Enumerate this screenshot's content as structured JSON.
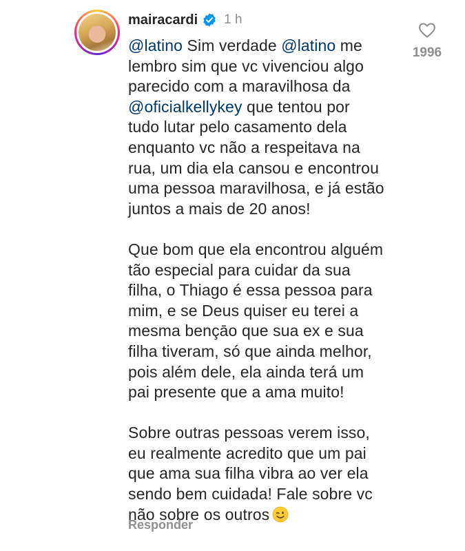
{
  "comment": {
    "username": "mairacardi",
    "verified": true,
    "time": "1 h",
    "likes": "1996",
    "reply_label": "Responder",
    "icons": {
      "avatar": "profile-avatar",
      "verified": "verified-badge-icon",
      "like": "heart-icon",
      "emoji": "winking-face-emoji"
    },
    "colors": {
      "mention": "#00376b",
      "verified": "#0095f6",
      "muted": "#8e8e8e",
      "text": "#262626"
    },
    "paragraph1": {
      "l1_mention1": "@latino",
      "l1_text": " Sim verdade ",
      "l1_mention2": "@latino",
      "l1_tail": " me",
      "l2": "lembro sim que vc vivenciou algo",
      "l3": "parecido com a maravilhosa da",
      "l4_mention": "@oficialkellykey",
      "l4_text": " que tentou por",
      "l5": "tudo lutar pelo casamento dela",
      "l6": "enquanto vc não a respeitava na",
      "l7": "rua, um dia ela cansou e encontrou",
      "l8": "uma pessoa maravilhosa, e já estão",
      "l9": "juntos a mais de 20 anos!"
    },
    "paragraph2": [
      "Que bom que ela encontrou alguém",
      "tão especial para cuidar da sua",
      "filha, o Thiago é essa pessoa para",
      "mim, e se Deus quiser eu terei a",
      "mesma bençāo que sua ex e sua",
      "filha tiveram, só que ainda melhor,",
      "pois além dele, ela ainda terá um",
      "pai presente que a ama muito!"
    ],
    "paragraph3": [
      "Sobre outras pessoas verem isso,",
      "eu realmente acredito que um pai",
      "que ama sua filha vibra ao ver ela",
      "sendo bem cuidada! Fale sobre vc"
    ],
    "paragraph3_last": "não sobre os outros"
  }
}
